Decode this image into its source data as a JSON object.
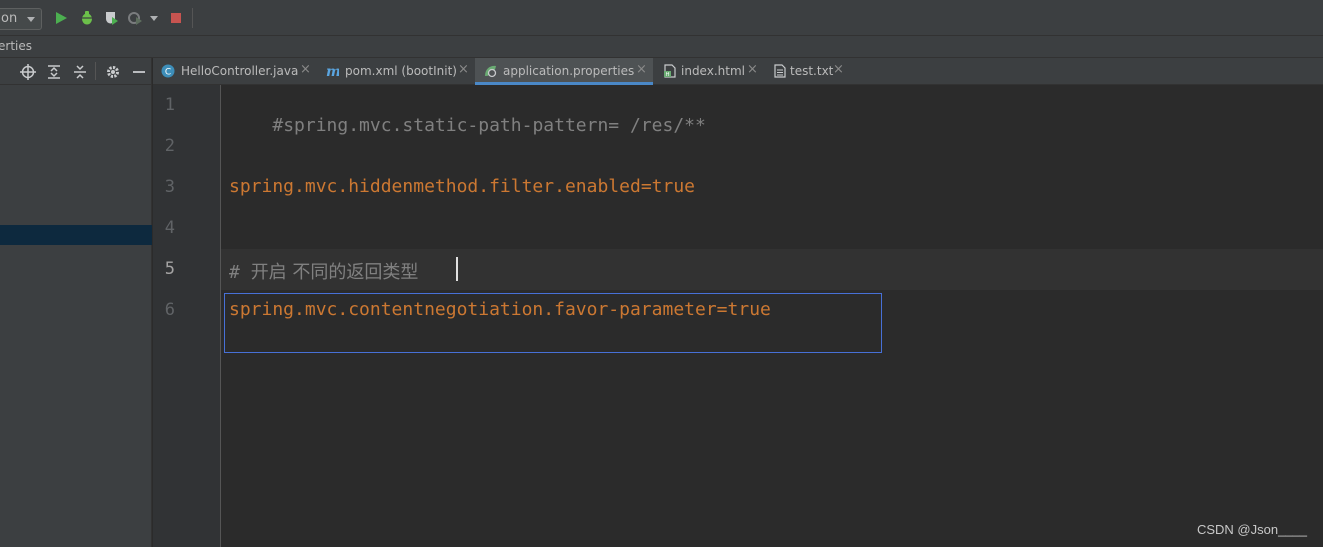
{
  "toolbar": {
    "run_config_label": "on",
    "colors": {
      "run": "#4caf50",
      "debug": "#6cc04a",
      "stop": "#c75450"
    }
  },
  "breadcrumb": {
    "text": "erties"
  },
  "project_panel": {
    "header_icons": [
      "crosshair-icon",
      "expand-all-icon",
      "collapse-all-icon",
      "gear-icon",
      "minimize-icon"
    ]
  },
  "tabs": [
    {
      "label": "HelloController.java",
      "icon": "java-class-icon",
      "active": false
    },
    {
      "label": "pom.xml (bootInit)",
      "icon": "maven-icon",
      "active": false
    },
    {
      "label": "application.properties",
      "icon": "spring-properties-icon",
      "active": true
    },
    {
      "label": "index.html",
      "icon": "html-file-icon",
      "active": false
    },
    {
      "label": "test.txt",
      "icon": "text-file-icon",
      "active": false
    }
  ],
  "editor": {
    "lines": [
      {
        "num": "1",
        "comment": "#spring.mvc.static-path-pattern= /res/**"
      },
      {
        "num": "2"
      },
      {
        "num": "3",
        "key": "spring.mvc.hiddenmethod.filter.enabled",
        "eq": "=",
        "val": "true"
      },
      {
        "num": "4"
      },
      {
        "num": "5",
        "comment_prefix": "# ",
        "comment_cjk": "开启 不同的返回类型",
        "current": true
      },
      {
        "num": "6",
        "key": "spring.mvc.contentnegotiation.favor-parameter",
        "eq": "=",
        "val": "true"
      }
    ]
  },
  "watermark": "CSDN @Json____"
}
